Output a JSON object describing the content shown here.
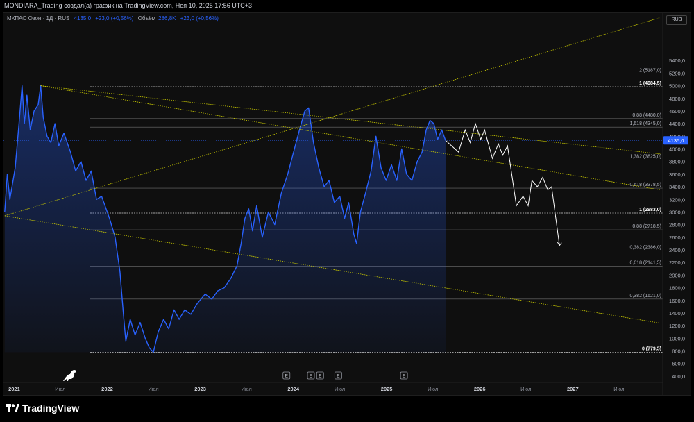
{
  "header": {
    "title": "MONDIARA_Trading создал(а) график на TradingView.com, Ноя 10, 2025 17:56 UTC+3"
  },
  "legend": {
    "symbol": "МКПАО Озон · 1Д · RUS",
    "price": "4135,0",
    "change": "+23,0 (+0,56%)",
    "volume_label": "Объём",
    "volume": "286,8K",
    "volume_change": "+23,0 (+0,56%)"
  },
  "currency": "RUB",
  "last_price_label": "4135,0",
  "footer": {
    "logo": "TradingView"
  },
  "colors": {
    "background": "#0f0f0f",
    "price_line": "#2962ff",
    "projection": "#ffffff",
    "trend": "#c8c800",
    "fib": "#8a8a8a"
  },
  "chart_data": {
    "type": "area",
    "ylim": [
      300,
      6150
    ],
    "xlim": [
      "2020-11-20",
      "2027-12-20"
    ],
    "y_ticks": [
      400,
      600,
      800,
      1000,
      1200,
      1400,
      1600,
      1800,
      2000,
      2200,
      2400,
      2600,
      2800,
      3000,
      3200,
      3400,
      3600,
      3800,
      4000,
      4200,
      4400,
      4600,
      4800,
      5000,
      5200,
      5400
    ],
    "y_tick_labels": [
      "400,0",
      "600,0",
      "800,0",
      "1000,0",
      "1200,0",
      "1400,0",
      "1600,0",
      "1800,0",
      "2000,0",
      "2200,0",
      "2400,0",
      "2600,0",
      "2800,0",
      "3000,0",
      "3200,0",
      "3400,0",
      "3600,0",
      "3800,0",
      "4000,0",
      "4200,0",
      "4400,0",
      "4600,0",
      "4800,0",
      "5000,0",
      "5200,0",
      "5400,0"
    ],
    "x_ticks": [
      {
        "date": "2021-01-01",
        "label": "2021"
      },
      {
        "date": "2021-07-01",
        "label": "Июл"
      },
      {
        "date": "2022-01-01",
        "label": "2022"
      },
      {
        "date": "2022-07-01",
        "label": "Июл"
      },
      {
        "date": "2023-01-01",
        "label": "2023"
      },
      {
        "date": "2023-07-01",
        "label": "Июл"
      },
      {
        "date": "2024-01-01",
        "label": "2024"
      },
      {
        "date": "2024-07-01",
        "label": "Июл"
      },
      {
        "date": "2025-01-01",
        "label": "2025"
      },
      {
        "date": "2025-07-01",
        "label": "Июл"
      },
      {
        "date": "2026-01-01",
        "label": "2026"
      },
      {
        "date": "2026-07-01",
        "label": "Июл"
      },
      {
        "date": "2027-01-01",
        "label": "2027"
      },
      {
        "date": "2027-07-01",
        "label": "Июл"
      }
    ],
    "series": [
      {
        "points": [
          [
            "2020-11-25",
            3000
          ],
          [
            "2020-12-05",
            3600
          ],
          [
            "2020-12-15",
            3200
          ],
          [
            "2021-01-05",
            3700
          ],
          [
            "2021-01-20",
            4400
          ],
          [
            "2021-02-01",
            5000
          ],
          [
            "2021-02-10",
            4400
          ],
          [
            "2021-02-20",
            4850
          ],
          [
            "2021-03-05",
            4300
          ],
          [
            "2021-03-20",
            4600
          ],
          [
            "2021-04-05",
            4700
          ],
          [
            "2021-04-15",
            5000
          ],
          [
            "2021-04-25",
            4500
          ],
          [
            "2021-05-10",
            4200
          ],
          [
            "2021-05-25",
            4100
          ],
          [
            "2021-06-10",
            4400
          ],
          [
            "2021-06-25",
            4050
          ],
          [
            "2021-07-15",
            4250
          ],
          [
            "2021-08-10",
            3950
          ],
          [
            "2021-08-30",
            3650
          ],
          [
            "2021-09-20",
            3800
          ],
          [
            "2021-10-10",
            3500
          ],
          [
            "2021-10-30",
            3650
          ],
          [
            "2021-11-20",
            3200
          ],
          [
            "2021-12-10",
            3250
          ],
          [
            "2022-01-10",
            2900
          ],
          [
            "2022-02-01",
            2600
          ],
          [
            "2022-02-20",
            2050
          ],
          [
            "2022-03-05",
            1400
          ],
          [
            "2022-03-15",
            950
          ],
          [
            "2022-04-01",
            1300
          ],
          [
            "2022-04-20",
            1050
          ],
          [
            "2022-05-10",
            1250
          ],
          [
            "2022-05-30",
            1000
          ],
          [
            "2022-06-15",
            850
          ],
          [
            "2022-07-01",
            780
          ],
          [
            "2022-07-20",
            1100
          ],
          [
            "2022-08-10",
            1300
          ],
          [
            "2022-08-30",
            1150
          ],
          [
            "2022-09-20",
            1450
          ],
          [
            "2022-10-10",
            1300
          ],
          [
            "2022-11-01",
            1450
          ],
          [
            "2022-11-25",
            1380
          ],
          [
            "2022-12-20",
            1550
          ],
          [
            "2023-01-20",
            1700
          ],
          [
            "2023-02-15",
            1620
          ],
          [
            "2023-03-10",
            1750
          ],
          [
            "2023-04-05",
            1800
          ],
          [
            "2023-05-01",
            1950
          ],
          [
            "2023-05-25",
            2150
          ],
          [
            "2023-06-10",
            2500
          ],
          [
            "2023-06-25",
            2900
          ],
          [
            "2023-07-10",
            3050
          ],
          [
            "2023-07-25",
            2700
          ],
          [
            "2023-08-10",
            3100
          ],
          [
            "2023-09-01",
            2600
          ],
          [
            "2023-09-25",
            3000
          ],
          [
            "2023-10-20",
            2800
          ],
          [
            "2023-11-15",
            3300
          ],
          [
            "2023-12-10",
            3600
          ],
          [
            "2024-01-05",
            4000
          ],
          [
            "2024-01-25",
            4300
          ],
          [
            "2024-02-15",
            4600
          ],
          [
            "2024-03-01",
            4650
          ],
          [
            "2024-03-20",
            4100
          ],
          [
            "2024-04-10",
            3700
          ],
          [
            "2024-05-01",
            3400
          ],
          [
            "2024-05-20",
            3500
          ],
          [
            "2024-06-10",
            3150
          ],
          [
            "2024-07-01",
            3250
          ],
          [
            "2024-07-20",
            2900
          ],
          [
            "2024-08-05",
            3150
          ],
          [
            "2024-08-25",
            2650
          ],
          [
            "2024-09-05",
            2500
          ],
          [
            "2024-09-20",
            3000
          ],
          [
            "2024-10-10",
            3300
          ],
          [
            "2024-11-01",
            3650
          ],
          [
            "2024-11-20",
            4200
          ],
          [
            "2024-12-10",
            3700
          ],
          [
            "2024-12-30",
            3500
          ],
          [
            "2025-01-20",
            3750
          ],
          [
            "2025-02-10",
            3500
          ],
          [
            "2025-03-01",
            4000
          ],
          [
            "2025-03-20",
            3600
          ],
          [
            "2025-04-10",
            3500
          ],
          [
            "2025-05-01",
            3800
          ],
          [
            "2025-05-20",
            3950
          ],
          [
            "2025-06-05",
            4300
          ],
          [
            "2025-06-20",
            4450
          ],
          [
            "2025-07-05",
            4400
          ],
          [
            "2025-07-20",
            4150
          ],
          [
            "2025-08-05",
            4300
          ],
          [
            "2025-08-20",
            4135
          ]
        ]
      },
      {
        "points": [
          [
            "2025-08-20",
            4135
          ],
          [
            "2025-10-10",
            3950
          ],
          [
            "2025-11-05",
            4300
          ],
          [
            "2025-11-25",
            4100
          ],
          [
            "2025-12-15",
            4400
          ],
          [
            "2026-01-05",
            4150
          ],
          [
            "2026-01-20",
            4300
          ],
          [
            "2026-02-20",
            3850
          ],
          [
            "2026-03-15",
            4080
          ],
          [
            "2026-04-01",
            3900
          ],
          [
            "2026-04-20",
            4050
          ],
          [
            "2026-05-25",
            3100
          ],
          [
            "2026-06-20",
            3250
          ],
          [
            "2026-07-10",
            3100
          ],
          [
            "2026-07-25",
            3500
          ],
          [
            "2026-08-15",
            3400
          ],
          [
            "2026-09-05",
            3550
          ],
          [
            "2026-09-25",
            3350
          ],
          [
            "2026-10-10",
            3400
          ],
          [
            "2026-11-10",
            2470
          ]
        ]
      }
    ],
    "trendlines": [
      {
        "from": [
          "2020-11-25",
          2940
        ],
        "to": [
          "2027-12-10",
          6080
        ]
      },
      {
        "from": [
          "2020-11-25",
          2940
        ],
        "to": [
          "2027-12-10",
          1240
        ]
      },
      {
        "from": [
          "2021-04-15",
          5000
        ],
        "to": [
          "2027-12-10",
          3350
        ]
      },
      {
        "from": [
          "2021-04-15",
          5000
        ],
        "to": [
          "2027-12-10",
          3920
        ]
      }
    ],
    "fib_levels": [
      {
        "label": "2 (5187,0)",
        "value": 5187,
        "bold": false
      },
      {
        "label": "1 (4984,5)",
        "value": 4984.5,
        "bold": true
      },
      {
        "label": "0,88 (4480,0)",
        "value": 4480,
        "bold": false
      },
      {
        "label": "1,618 (4345,0)",
        "value": 4345,
        "bold": false
      },
      {
        "label": "1,382 (3825,0)",
        "value": 3825,
        "bold": false
      },
      {
        "label": "0,618 (3378,5)",
        "value": 3378.5,
        "bold": false
      },
      {
        "label": "1 (2983,0)",
        "value": 2983,
        "bold": true
      },
      {
        "label": "0,88 (2718,5)",
        "value": 2718.5,
        "bold": false
      },
      {
        "label": "0,382 (2386,0)",
        "value": 2386,
        "bold": false
      },
      {
        "label": "0,618 (2141,5)",
        "value": 2141.5,
        "bold": false
      },
      {
        "label": "0,382 (1621,0)",
        "value": 1621,
        "bold": false
      },
      {
        "label": "0 (779,5)",
        "value": 779.5,
        "bold": true
      }
    ],
    "event_markers": [
      {
        "date": "2023-12-05",
        "label": "E"
      },
      {
        "date": "2024-03-10",
        "label": "E"
      },
      {
        "date": "2024-04-15",
        "label": "E"
      },
      {
        "date": "2024-06-25",
        "label": "E"
      },
      {
        "date": "2025-03-10",
        "label": "E"
      }
    ]
  }
}
